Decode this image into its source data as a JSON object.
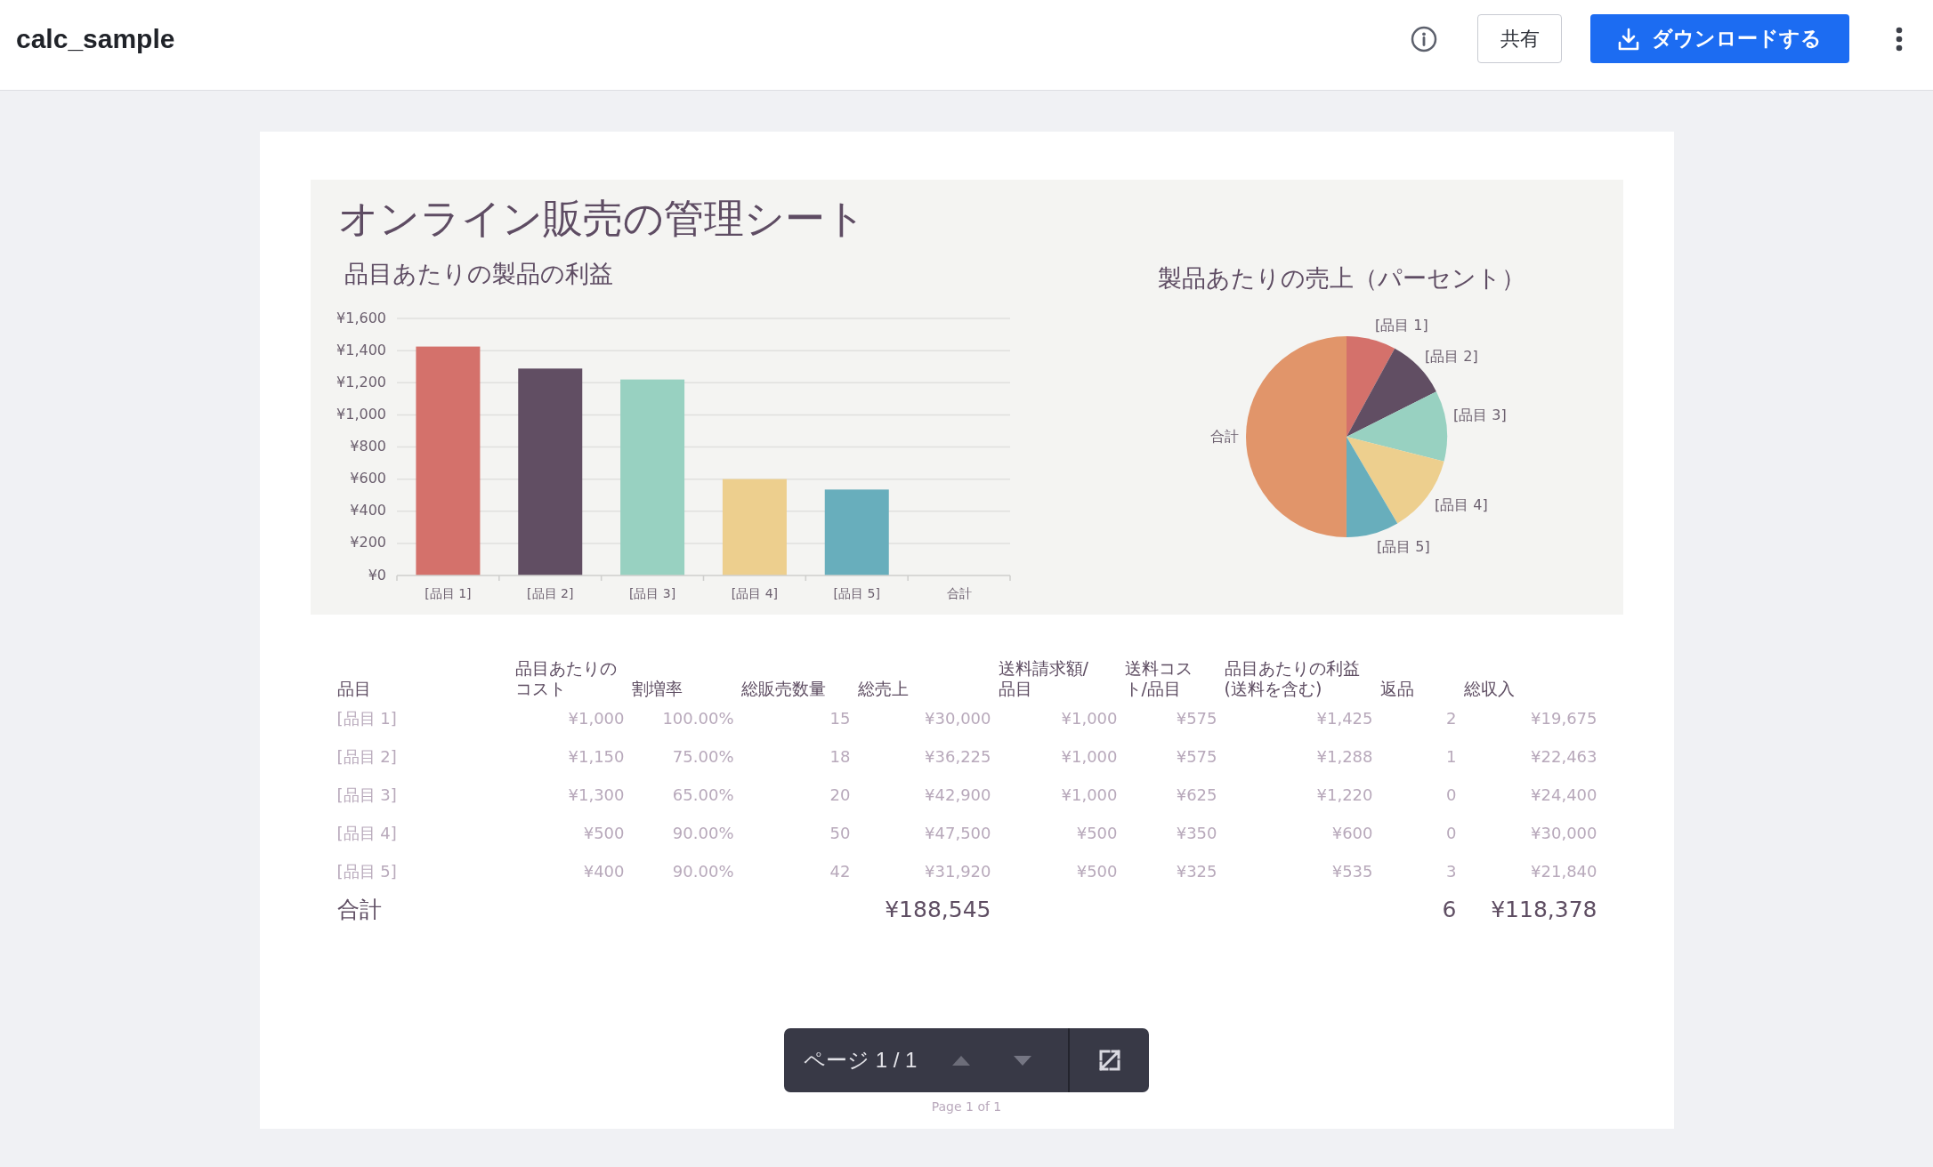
{
  "header": {
    "title": "calc_sample",
    "share_button": "共有",
    "download_button": "ダウンロードする"
  },
  "document": {
    "title": "オンライン販売の管理シート",
    "bar_chart": {
      "chart_data": {
        "type": "bar",
        "title": "品目あたりの製品の利益",
        "categories": [
          "[品目 1]",
          "[品目 2]",
          "[品目 3]",
          "[品目 4]",
          "[品目 5]",
          "合計"
        ],
        "values": [
          1425,
          1288,
          1220,
          600,
          535,
          null
        ],
        "colors": [
          "#d4716b",
          "#614e63",
          "#98d1c1",
          "#edcf8e",
          "#68aebc",
          null
        ],
        "grid": true,
        "ylim": [
          0,
          1600
        ],
        "yticks": [
          {
            "value": 0,
            "label": "¥0"
          },
          {
            "value": 200,
            "label": "¥200"
          },
          {
            "value": 400,
            "label": "¥400"
          },
          {
            "value": 600,
            "label": "¥600"
          },
          {
            "value": 800,
            "label": "¥800"
          },
          {
            "value": 1000,
            "label": "¥1,000"
          },
          {
            "value": 1200,
            "label": "¥1,200"
          },
          {
            "value": 1400,
            "label": "¥1,400"
          },
          {
            "value": 1600,
            "label": "¥1,600"
          }
        ]
      }
    },
    "pie_chart": {
      "title": "製品あたりの売上（パーセント）",
      "slices": [
        {
          "label": "[品目 1]",
          "color": "#d4716b"
        },
        {
          "label": "[品目 2]",
          "color": "#614e63"
        },
        {
          "label": "[品目 3]",
          "color": "#98d1c1"
        },
        {
          "label": "[品目 4]",
          "color": "#edcf8e"
        },
        {
          "label": "[品目 5]",
          "color": "#68aebc"
        },
        {
          "label": "合計",
          "color": "#e1956a"
        }
      ]
    },
    "table": {
      "columns": [
        "品目",
        "品目あたりのコスト",
        "割増率",
        "総販売数量",
        "総売上",
        "送料請求額/品目",
        "送料コスト/品目",
        "品目あたりの利益(送料を含む)",
        "返品",
        "総収入"
      ],
      "rows": [
        {
          "cells": [
            "[品目 1]",
            "¥1,000",
            "100.00%",
            "15",
            "¥30,000",
            "¥1,000",
            "¥575",
            "¥1,425",
            "2",
            "¥19,675"
          ]
        },
        {
          "cells": [
            "[品目 2]",
            "¥1,150",
            "75.00%",
            "18",
            "¥36,225",
            "¥1,000",
            "¥575",
            "¥1,288",
            "1",
            "¥22,463"
          ]
        },
        {
          "cells": [
            "[品目 3]",
            "¥1,300",
            "65.00%",
            "20",
            "¥42,900",
            "¥1,000",
            "¥625",
            "¥1,220",
            "0",
            "¥24,400"
          ]
        },
        {
          "cells": [
            "[品目 4]",
            "¥500",
            "90.00%",
            "50",
            "¥47,500",
            "¥500",
            "¥350",
            "¥600",
            "0",
            "¥30,000"
          ]
        },
        {
          "cells": [
            "[品目 5]",
            "¥400",
            "90.00%",
            "42",
            "¥31,920",
            "¥500",
            "¥325",
            "¥535",
            "3",
            "¥21,840"
          ]
        }
      ],
      "total": {
        "label": "合計",
        "total_sales": "¥188,545",
        "returns": "6",
        "total_revenue": "¥118,378"
      }
    },
    "footer": "Page 1 of 1"
  },
  "pager": {
    "label": "ページ 1 / 1",
    "previous": {
      "disabled": true
    },
    "next": {
      "disabled": true
    }
  }
}
